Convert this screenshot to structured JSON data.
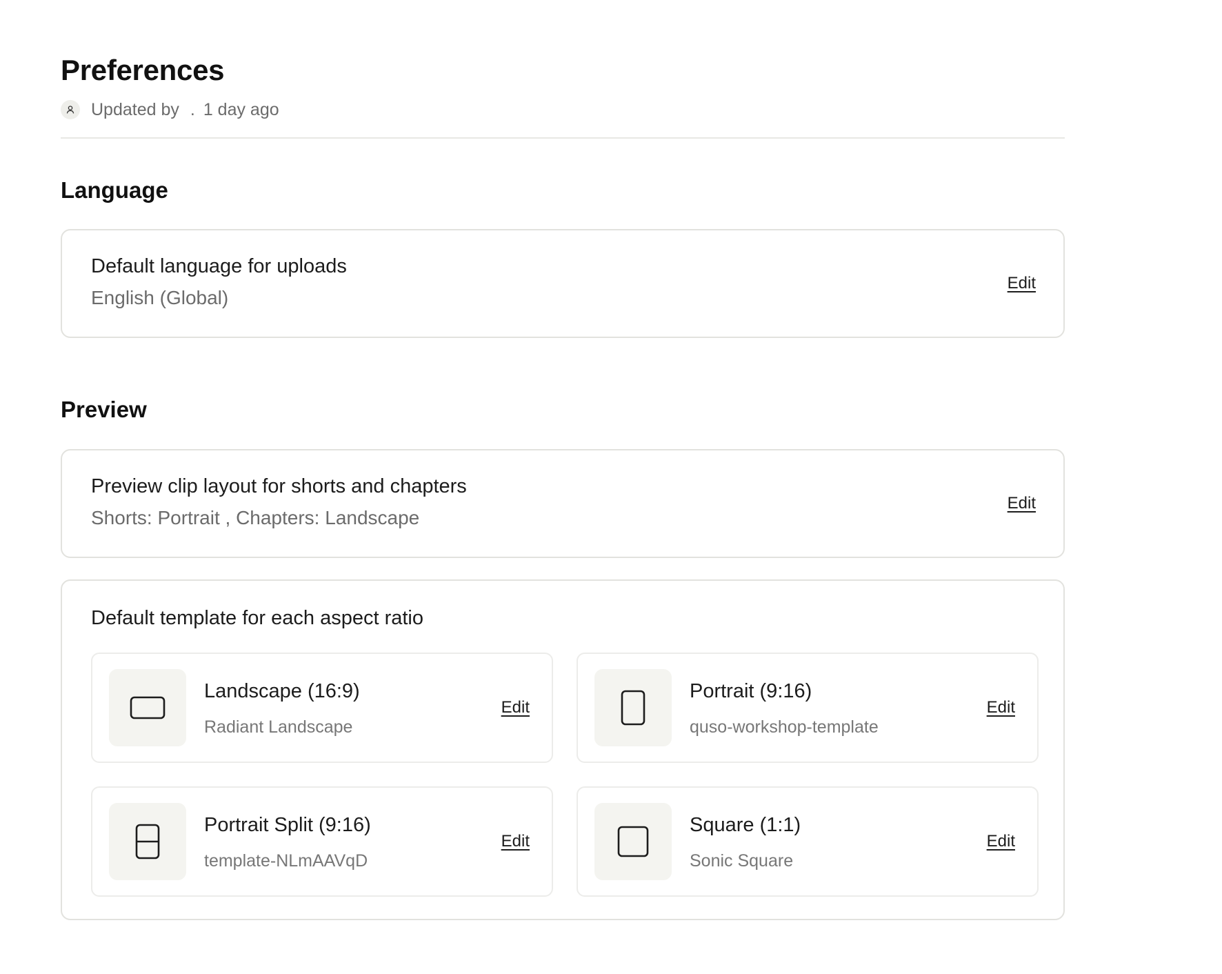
{
  "header": {
    "title": "Preferences",
    "updated_by": "Updated by",
    "separator": ".",
    "updated_when": "1 day ago",
    "avatar_icon": "user-icon"
  },
  "language": {
    "section_title": "Language",
    "label": "Default language for uploads",
    "value": "English (Global)",
    "edit_label": "Edit"
  },
  "preview": {
    "section_title": "Preview",
    "clip_layout": {
      "label": "Preview clip layout for shorts and chapters",
      "value": "Shorts: Portrait , Chapters: Landscape",
      "edit_label": "Edit"
    },
    "templates": {
      "label": "Default template for each aspect ratio",
      "items": [
        {
          "title": "Landscape (16:9)",
          "template": "Radiant Landscape",
          "edit_label": "Edit",
          "icon": "landscape-icon"
        },
        {
          "title": "Portrait (9:16)",
          "template": "quso-workshop-template",
          "edit_label": "Edit",
          "icon": "portrait-icon"
        },
        {
          "title": "Portrait Split (9:16)",
          "template": "template-NLmAAVqD",
          "edit_label": "Edit",
          "icon": "portrait-split-icon"
        },
        {
          "title": "Square (1:1)",
          "template": "Sonic Square",
          "edit_label": "Edit",
          "icon": "square-icon"
        }
      ]
    }
  }
}
